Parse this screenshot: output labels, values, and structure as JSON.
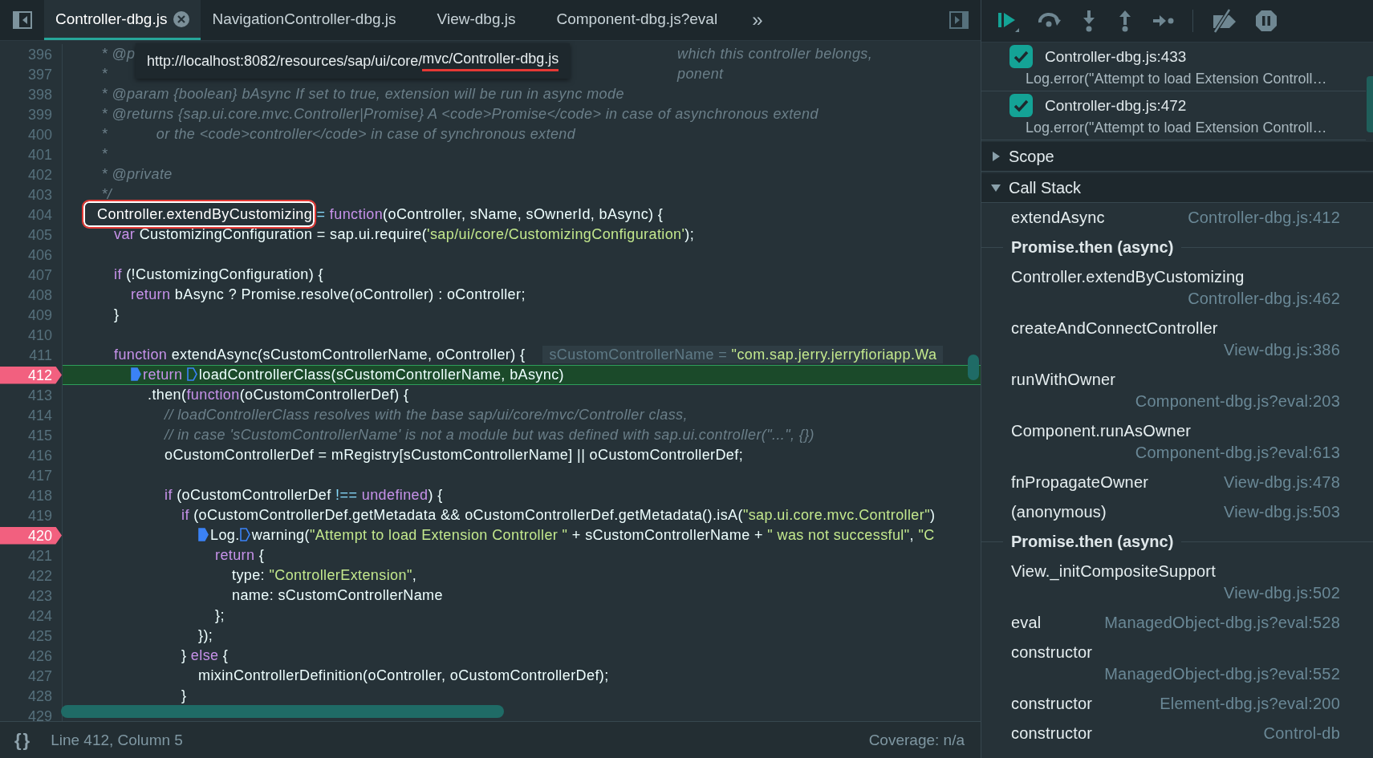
{
  "editor_tabs": {
    "tabs": [
      {
        "label": "Controller-dbg.js",
        "selected": true,
        "closable": true
      },
      {
        "label": "NavigationController-dbg.js",
        "selected": false,
        "closable": false
      },
      {
        "label": "View-dbg.js",
        "selected": false,
        "closable": false
      },
      {
        "label": "Component-dbg.js?eval",
        "selected": false,
        "closable": false
      }
    ],
    "overflow": "»"
  },
  "tooltip": {
    "text": "http://localhost:8082/resources/sap/ui/core/",
    "underlined": "mvc/Controller-dbg.js"
  },
  "code_lines": [
    {
      "number": "396",
      "breakpoint": false,
      "current": false,
      "segs": [
        {
          "kind": "c",
          "text": " * @p"
        },
        {
          "kind": "cfar",
          "text": "which this controller belongs,"
        }
      ]
    },
    {
      "number": "397",
      "breakpoint": false,
      "current": false,
      "segs": [
        {
          "kind": "c",
          "text": " *"
        },
        {
          "kind": "cfar",
          "text": "ponent"
        }
      ]
    },
    {
      "number": "398",
      "breakpoint": false,
      "current": false,
      "segs": [
        {
          "kind": "c",
          "text": " * @param {boolean} bAsync If set to true, extension will be run in async mode"
        }
      ]
    },
    {
      "number": "399",
      "breakpoint": false,
      "current": false,
      "segs": [
        {
          "kind": "c",
          "text": " * @returns {sap.ui.core.mvc.Controller|Promise} A <code>Promise</code> in case of asynchronous extend"
        }
      ]
    },
    {
      "number": "400",
      "breakpoint": false,
      "current": false,
      "segs": [
        {
          "kind": "c",
          "text": " *\t\t\t  or the <code>controller</code> in case of synchronous extend"
        }
      ]
    },
    {
      "number": "401",
      "breakpoint": false,
      "current": false,
      "segs": [
        {
          "kind": "c",
          "text": " *"
        }
      ]
    },
    {
      "number": "402",
      "breakpoint": false,
      "current": false,
      "segs": [
        {
          "kind": "c",
          "text": " * @private"
        }
      ]
    },
    {
      "number": "403",
      "breakpoint": false,
      "current": false,
      "segs": [
        {
          "kind": "c",
          "text": " */"
        }
      ]
    },
    {
      "number": "404",
      "breakpoint": false,
      "current": false,
      "segs": [
        {
          "kind": "ann",
          "text": "Controller.extendByCustomizing"
        },
        {
          "kind": "o",
          "text": " ="
        },
        {
          "kind": "k",
          "text": " function"
        },
        {
          "kind": "p",
          "text": "(oController, sName, sOwnerId, bAsync) {"
        }
      ]
    },
    {
      "number": "405",
      "breakpoint": false,
      "current": false,
      "segs": [
        {
          "kind": "k",
          "text": "\tvar"
        },
        {
          "kind": "p",
          "text": " CustomizingConfiguration = sap.ui.require("
        },
        {
          "kind": "s",
          "text": "'sap/ui/core/CustomizingConfiguration'"
        },
        {
          "kind": "p",
          "text": ");"
        }
      ]
    },
    {
      "number": "406",
      "breakpoint": false,
      "current": false
    },
    {
      "number": "407",
      "breakpoint": false,
      "current": false,
      "segs": [
        {
          "kind": "k",
          "text": "\tif"
        },
        {
          "kind": "p",
          "text": " (!CustomizingConfiguration) {"
        }
      ]
    },
    {
      "number": "408",
      "breakpoint": false,
      "current": false,
      "segs": [
        {
          "kind": "k",
          "text": "\t\treturn"
        },
        {
          "kind": "p",
          "text": " bAsync ? Promise.resolve(oController) : oController;"
        }
      ]
    },
    {
      "number": "409",
      "breakpoint": false,
      "current": false,
      "segs": [
        {
          "kind": "p",
          "text": "\t}"
        }
      ]
    },
    {
      "number": "410",
      "breakpoint": false,
      "current": false
    },
    {
      "number": "411",
      "breakpoint": false,
      "current": false,
      "segs": [
        {
          "kind": "k",
          "text": "\tfunction"
        },
        {
          "kind": "p",
          "text": " extendAsync(sCustomControllerName, oController) {"
        },
        {
          "kind": "iv",
          "name": "sCustomControllerName",
          "op": " = ",
          "value": "\"com.sap.jerry.jerryfioriapp.Wa"
        }
      ]
    },
    {
      "number": "412",
      "breakpoint": true,
      "current": true,
      "segs": [
        {
          "kind": "k",
          "text": "\t\treturn",
          "marker_filled": true
        },
        {
          "kind": "p",
          "text": " loadControllerClass(sCustomControllerName, bAsync)",
          "marker_filled": false
        }
      ]
    },
    {
      "number": "413",
      "breakpoint": false,
      "current": false,
      "segs": [
        {
          "kind": "p",
          "text": "\t\t\t.then("
        },
        {
          "kind": "k",
          "text": "function"
        },
        {
          "kind": "p",
          "text": "(oCustomControllerDef) {"
        }
      ]
    },
    {
      "number": "414",
      "breakpoint": false,
      "current": false,
      "segs": [
        {
          "kind": "c",
          "text": "\t\t\t\t// loadControllerClass resolves with the base sap/ui/core/mvc/Controller class,"
        }
      ]
    },
    {
      "number": "415",
      "breakpoint": false,
      "current": false,
      "segs": [
        {
          "kind": "c",
          "text": "\t\t\t\t// in case 'sCustomControllerName' is not a module but was defined with sap.ui.controller(\"...\", {})"
        }
      ]
    },
    {
      "number": "416",
      "breakpoint": false,
      "current": false,
      "segs": [
        {
          "kind": "p",
          "text": "\t\t\t\toCustomControllerDef = mRegistry[sCustomControllerName] || oCustomControllerDef;"
        }
      ]
    },
    {
      "number": "417",
      "breakpoint": false,
      "current": false
    },
    {
      "number": "418",
      "breakpoint": false,
      "current": false,
      "segs": [
        {
          "kind": "k",
          "text": "\t\t\t\tif"
        },
        {
          "kind": "p",
          "text": " (oCustomControllerDef"
        },
        {
          "kind": "o",
          "text": " !=="
        },
        {
          "kind": "k",
          "text": " undefined"
        },
        {
          "kind": "p",
          "text": ") {"
        }
      ]
    },
    {
      "number": "419",
      "breakpoint": false,
      "current": false,
      "segs": [
        {
          "kind": "k",
          "text": "\t\t\t\t\tif"
        },
        {
          "kind": "p",
          "text": " (oCustomControllerDef.getMetadata && oCustomControllerDef.getMetadata().isA("
        },
        {
          "kind": "s",
          "text": "\"sap.ui.core.mvc.Controller\""
        },
        {
          "kind": "p",
          "text": ")"
        }
      ]
    },
    {
      "number": "420",
      "breakpoint": true,
      "current": false,
      "segs": [
        {
          "kind": "p",
          "text": "\t\t\t\t\t\tLog.",
          "marker_filled": true
        },
        {
          "kind": "p",
          "text": "warning(",
          "marker_filled": false
        },
        {
          "kind": "s",
          "text": "\"Attempt to load Extension Controller \""
        },
        {
          "kind": "p",
          "text": " + sCustomControllerName +"
        },
        {
          "kind": "s",
          "text": " \" was not successful\""
        },
        {
          "kind": "p",
          "text": ","
        },
        {
          "kind": "s",
          "text": " \"C"
        }
      ]
    },
    {
      "number": "421",
      "breakpoint": false,
      "current": false,
      "segs": [
        {
          "kind": "k",
          "text": "\t\t\t\t\t\t\treturn"
        },
        {
          "kind": "p",
          "text": " {"
        }
      ]
    },
    {
      "number": "422",
      "breakpoint": false,
      "current": false,
      "segs": [
        {
          "kind": "p",
          "text": "\t\t\t\t\t\t\t\ttype:"
        },
        {
          "kind": "s",
          "text": " \"ControllerExtension\""
        },
        {
          "kind": "p",
          "text": ","
        }
      ]
    },
    {
      "number": "423",
      "breakpoint": false,
      "current": false,
      "segs": [
        {
          "kind": "p",
          "text": "\t\t\t\t\t\t\t\tname: sCustomControllerName"
        }
      ]
    },
    {
      "number": "424",
      "breakpoint": false,
      "current": false,
      "segs": [
        {
          "kind": "p",
          "text": "\t\t\t\t\t\t\t};"
        }
      ]
    },
    {
      "number": "425",
      "breakpoint": false,
      "current": false,
      "segs": [
        {
          "kind": "p",
          "text": "\t\t\t\t\t\t});"
        }
      ]
    },
    {
      "number": "426",
      "breakpoint": false,
      "current": false,
      "segs": [
        {
          "kind": "p",
          "text": "\t\t\t\t\t}"
        },
        {
          "kind": "k",
          "text": " else"
        },
        {
          "kind": "p",
          "text": " {"
        }
      ]
    },
    {
      "number": "427",
      "breakpoint": false,
      "current": false,
      "segs": [
        {
          "kind": "p",
          "text": "\t\t\t\t\t\tmixinControllerDefinition(oController, oCustomControllerDef);"
        }
      ]
    },
    {
      "number": "428",
      "breakpoint": false,
      "current": false,
      "segs": [
        {
          "kind": "p",
          "text": "\t\t\t\t\t}"
        }
      ]
    },
    {
      "number": "429",
      "breakpoint": false,
      "current": false
    }
  ],
  "status_bar": {
    "format": "{}",
    "position": "Line 412, Column 5",
    "coverage": "Coverage: n/a"
  },
  "breakpoints": [
    {
      "location": "Controller-dbg.js:433",
      "code": "Log.error(\"Attempt to load Extension Controll…",
      "checked": true
    },
    {
      "location": "Controller-dbg.js:472",
      "code": "Log.error(\"Attempt to load Extension Controll…",
      "checked": true
    }
  ],
  "sections": [
    {
      "title": "Scope",
      "expanded": false
    },
    {
      "title": "Call Stack",
      "expanded": true,
      "frames": [
        {
          "kind": "frame",
          "name": "extendAsync",
          "location": "Controller-dbg.js:412"
        },
        {
          "kind": "async",
          "name": "Promise.then (async)"
        },
        {
          "kind": "frame",
          "name": "Controller.extendByCustomizing",
          "location": "Controller-dbg.js:462"
        },
        {
          "kind": "frame",
          "name": "createAndConnectController",
          "location": "View-dbg.js:386"
        },
        {
          "kind": "frame",
          "name": "runWithOwner",
          "location": "Component-dbg.js?eval:203"
        },
        {
          "kind": "frame",
          "name": "Component.runAsOwner",
          "location": "Component-dbg.js?eval:613"
        },
        {
          "kind": "frame",
          "name": "fnPropagateOwner",
          "location": "View-dbg.js:478"
        },
        {
          "kind": "frame",
          "name": "(anonymous)",
          "location": "View-dbg.js:503"
        },
        {
          "kind": "async",
          "name": "Promise.then (async)"
        },
        {
          "kind": "frame",
          "name": "View._initCompositeSupport",
          "location": "View-dbg.js:502"
        },
        {
          "kind": "frame",
          "name": "eval",
          "location": "ManagedObject-dbg.js?eval:528"
        },
        {
          "kind": "frame",
          "name": "constructor",
          "location": "ManagedObject-dbg.js?eval:552"
        },
        {
          "kind": "frame",
          "name": "constructor",
          "location": "Element-dbg.js?eval:200"
        },
        {
          "kind": "frame",
          "name": "constructor",
          "location": "Control-db"
        }
      ]
    }
  ]
}
